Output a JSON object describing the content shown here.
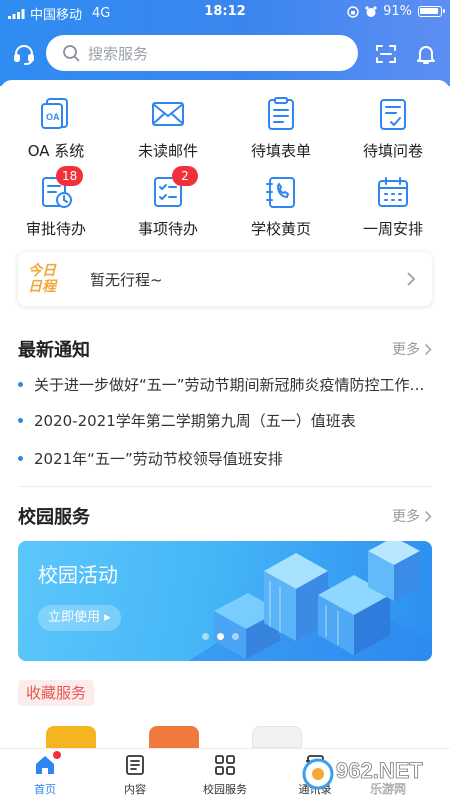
{
  "status_bar": {
    "carrier": "中国移动",
    "network": "4G",
    "time": "18:12",
    "battery": "91%"
  },
  "header": {
    "search_placeholder": "搜索服务",
    "icons": [
      "headset-icon",
      "scan-icon",
      "bell-icon"
    ]
  },
  "quick_menu": [
    {
      "label": "OA 系统",
      "icon": "oa-icon"
    },
    {
      "label": "未读邮件",
      "icon": "mail-icon"
    },
    {
      "label": "待填表单",
      "icon": "form-icon"
    },
    {
      "label": "待填问卷",
      "icon": "survey-icon"
    },
    {
      "label": "审批待办",
      "icon": "approval-icon",
      "badge": "18"
    },
    {
      "label": "事项待办",
      "icon": "todo-icon",
      "badge": "2"
    },
    {
      "label": "学校黄页",
      "icon": "phonebook-icon"
    },
    {
      "label": "一周安排",
      "icon": "calendar-icon"
    }
  ],
  "schedule": {
    "logo_line1": "今日",
    "logo_line2": "日程",
    "text": "暂无行程~"
  },
  "notices": {
    "title": "最新通知",
    "more": "更多",
    "items": [
      "关于进一步做好“五一”劳动节期间新冠肺炎疫情防控工作的通知",
      "2020-2021学年第二学期第九周（五一）值班表",
      "2021年“五一”劳动节校领导值班安排"
    ]
  },
  "campus_services": {
    "title": "校园服务",
    "more": "更多",
    "banner_title": "校园活动",
    "banner_button": "立即使用 ▸",
    "banner_slide_count": 3,
    "banner_active_slide": 2
  },
  "favorites": {
    "label": "收藏服务"
  },
  "tabbar": [
    {
      "label": "首页",
      "icon": "home-icon",
      "active": true
    },
    {
      "label": "内容",
      "icon": "content-icon",
      "active": false
    },
    {
      "label": "校园服务",
      "icon": "grid-icon",
      "active": false
    },
    {
      "label": "通讯录",
      "icon": "contacts-icon",
      "active": false
    }
  ],
  "watermark": "962.NET 乐游网",
  "colors": {
    "brand_blue": "#2f86f0",
    "badge_red": "#f2303a",
    "favorite_red": "#e8564f",
    "schedule_orange": "#f2a93b"
  }
}
